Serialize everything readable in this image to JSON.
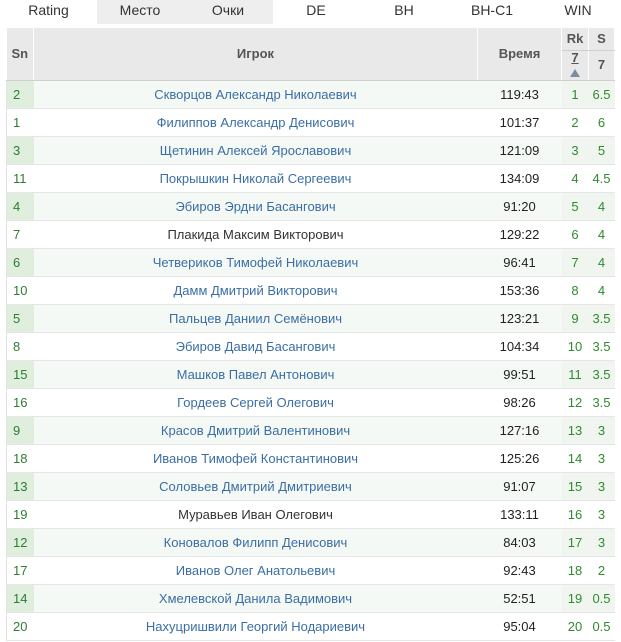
{
  "tabs": [
    {
      "label": "Rating",
      "active": false
    },
    {
      "label": "Место",
      "active": true
    },
    {
      "label": "Очки",
      "active": true
    },
    {
      "label": "DE",
      "active": false
    },
    {
      "label": "BH",
      "active": false
    },
    {
      "label": "BH-C1",
      "active": false
    },
    {
      "label": "WIN",
      "active": false
    }
  ],
  "table": {
    "headers": {
      "sn": "Sn",
      "player": "Игрок",
      "time": "Время",
      "rk": "Rk",
      "rk_sub": "7",
      "s": "S",
      "s_sub": "7"
    },
    "rows": [
      {
        "sn": "2",
        "name": "Скворцов Александр Николаевич",
        "time": "119:43",
        "rk": "1",
        "s": "6.5",
        "link": true
      },
      {
        "sn": "1",
        "name": "Филиппов Александр Денисович",
        "time": "101:37",
        "rk": "2",
        "s": "6",
        "link": true
      },
      {
        "sn": "3",
        "name": "Щетинин Алексей Ярославович",
        "time": "121:09",
        "rk": "3",
        "s": "5",
        "link": true
      },
      {
        "sn": "11",
        "name": "Покрышкин Николай Сергеевич",
        "time": "134:09",
        "rk": "4",
        "s": "4.5",
        "link": true
      },
      {
        "sn": "4",
        "name": "Эбиров Эрдни Басангович",
        "time": "91:20",
        "rk": "5",
        "s": "4",
        "link": true
      },
      {
        "sn": "7",
        "name": "Плакида Максим Викторович",
        "time": "129:22",
        "rk": "6",
        "s": "4",
        "link": false
      },
      {
        "sn": "6",
        "name": "Четвериков Тимофей Николаевич",
        "time": "96:41",
        "rk": "7",
        "s": "4",
        "link": true
      },
      {
        "sn": "10",
        "name": "Дамм Дмитрий Викторович",
        "time": "153:36",
        "rk": "8",
        "s": "4",
        "link": true
      },
      {
        "sn": "5",
        "name": "Пальцев Даниил Семёнович",
        "time": "123:21",
        "rk": "9",
        "s": "3.5",
        "link": true
      },
      {
        "sn": "8",
        "name": "Эбиров Давид Басангович",
        "time": "104:34",
        "rk": "10",
        "s": "3.5",
        "link": true
      },
      {
        "sn": "15",
        "name": "Машков Павел Антонович",
        "time": "99:51",
        "rk": "11",
        "s": "3.5",
        "link": true
      },
      {
        "sn": "16",
        "name": "Гордеев Сергей Олегович",
        "time": "98:26",
        "rk": "12",
        "s": "3.5",
        "link": true
      },
      {
        "sn": "9",
        "name": "Красов Дмитрий Валентинович",
        "time": "127:16",
        "rk": "13",
        "s": "3",
        "link": true
      },
      {
        "sn": "18",
        "name": "Иванов Тимофей Константинович",
        "time": "125:26",
        "rk": "14",
        "s": "3",
        "link": true
      },
      {
        "sn": "13",
        "name": "Соловьев Дмитрий Дмитриевич",
        "time": "91:07",
        "rk": "15",
        "s": "3",
        "link": true
      },
      {
        "sn": "19",
        "name": "Муравьев Иван Олегович",
        "time": "133:11",
        "rk": "16",
        "s": "3",
        "link": false
      },
      {
        "sn": "12",
        "name": "Коновалов Филипп Денисович",
        "time": "84:03",
        "rk": "17",
        "s": "3",
        "link": true
      },
      {
        "sn": "17",
        "name": "Иванов Олег Анатольевич",
        "time": "92:43",
        "rk": "18",
        "s": "2",
        "link": true
      },
      {
        "sn": "14",
        "name": "Хмелевской Данила Вадимович",
        "time": "52:51",
        "rk": "19",
        "s": "0.5",
        "link": true
      },
      {
        "sn": "20",
        "name": "Нахуцришвили Георгий Нодариевич",
        "time": "95:04",
        "rk": "20",
        "s": "0.5",
        "link": true
      }
    ]
  },
  "icons": {
    "sort": "sort-ascending-icon"
  },
  "colors": {
    "link": "#3a6ea5",
    "accent": "#2e8b2e",
    "header_bg": "#e9e9e9"
  }
}
